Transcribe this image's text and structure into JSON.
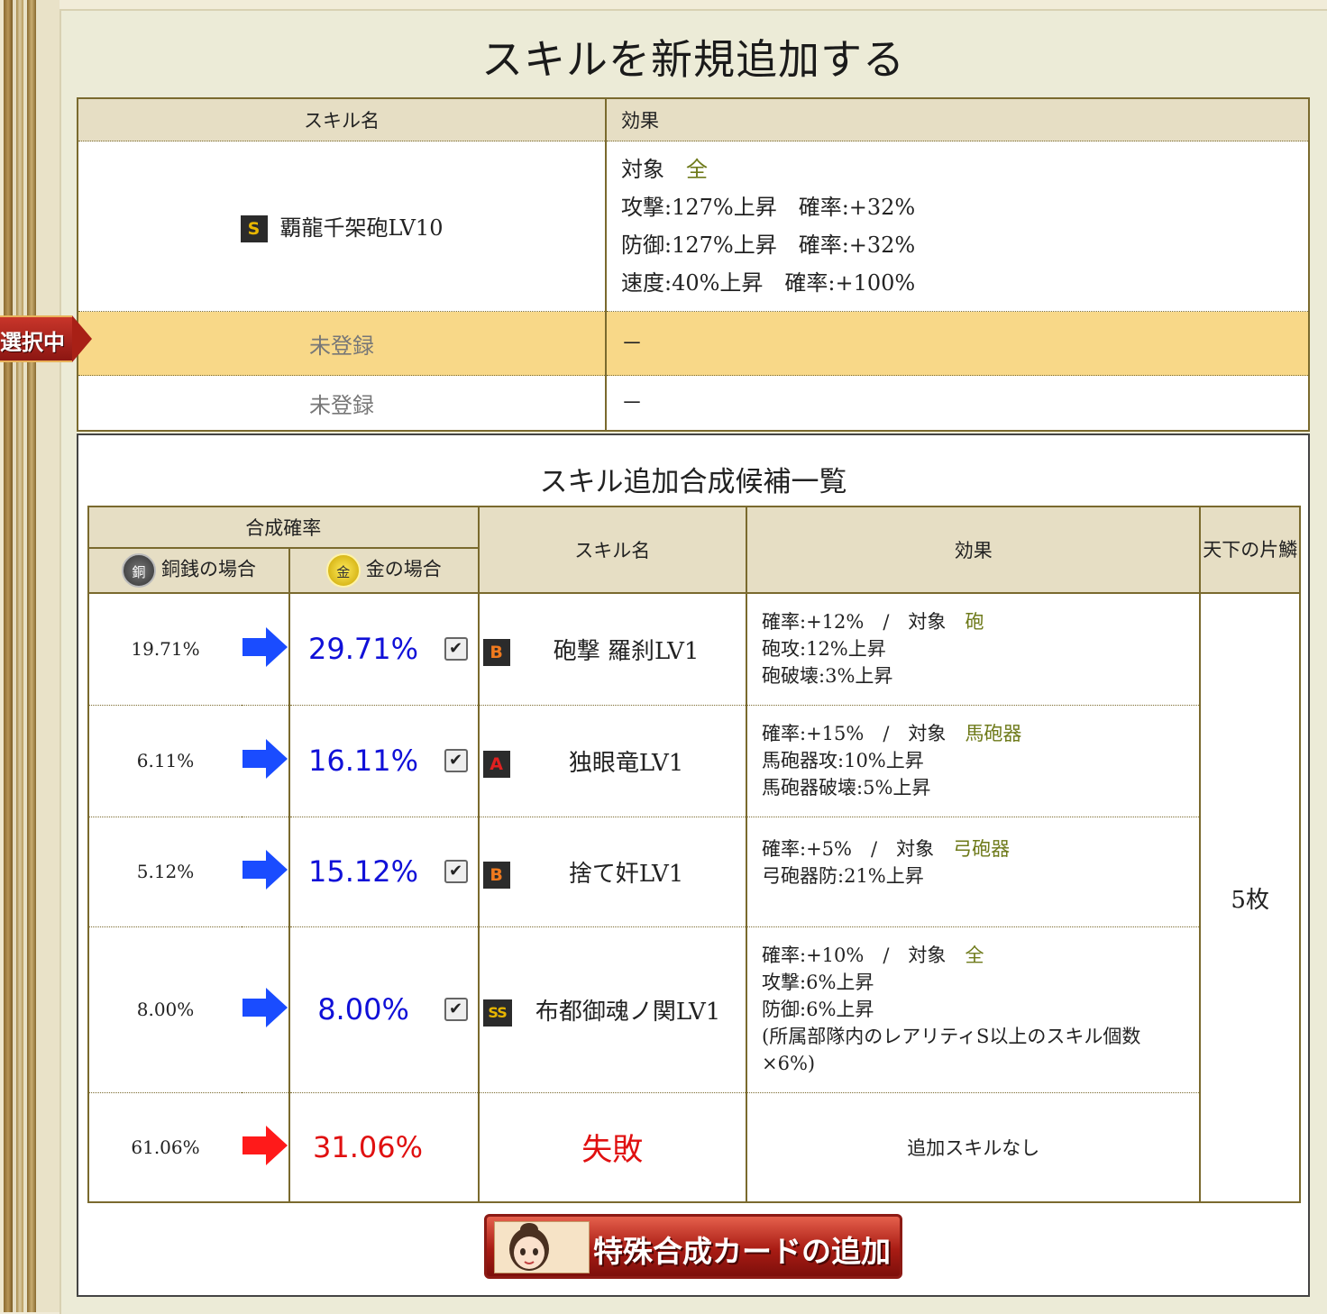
{
  "title": "スキルを新規追加する",
  "selected_tab": "選択中",
  "skills_table": {
    "col_name": "スキル名",
    "col_effect": "効果",
    "rows": [
      {
        "rank": "S",
        "name": "覇龍千架砲LV10",
        "target_label": "対象",
        "target_value": "全",
        "lines": [
          "攻撃:127%上昇　確率:+32%",
          "防御:127%上昇　確率:+32%",
          "速度:40%上昇　確率:+100%"
        ]
      },
      {
        "name": "未登録",
        "effect": "－"
      },
      {
        "name": "未登録",
        "effect": "－"
      }
    ]
  },
  "candidates": {
    "title": "スキル追加合成候補一覧",
    "col_rate": "合成確率",
    "col_copper": "銅銭の場合",
    "col_gold": "金の場合",
    "col_name": "スキル名",
    "col_effect": "効果",
    "col_tenka": "天下の片鱗",
    "tenka_value": "5枚",
    "coin_copper_glyph": "銅",
    "coin_gold_glyph": "金",
    "rows": [
      {
        "copper": "19.71%",
        "gold": "29.71%",
        "rank": "B",
        "name": "砲撃 羅刹LV1",
        "head": "確率:+12%　/　対象",
        "target": "砲",
        "lines": [
          "砲攻:12%上昇",
          "砲破壊:3%上昇"
        ]
      },
      {
        "copper": "6.11%",
        "gold": "16.11%",
        "rank": "A",
        "name": "独眼竜LV1",
        "head": "確率:+15%　/　対象",
        "target": "馬砲器",
        "lines": [
          "馬砲器攻:10%上昇",
          "馬砲器破壊:5%上昇"
        ]
      },
      {
        "copper": "5.12%",
        "gold": "15.12%",
        "rank": "B",
        "name": "捨て奸LV1",
        "head": "確率:+5%　/　対象",
        "target": "弓砲器",
        "lines": [
          "弓砲器防:21%上昇"
        ]
      },
      {
        "copper": "8.00%",
        "gold": "8.00%",
        "rank": "SS",
        "name": "布都御魂ノ関LV1",
        "head": "確率:+10%　/　対象",
        "target": "全",
        "lines": [
          "攻撃:6%上昇",
          "防御:6%上昇",
          "(所属部隊内のレアリティS以上のスキル個数",
          "×6%)"
        ]
      },
      {
        "copper": "61.06%",
        "gold": "31.06%",
        "name": "失敗",
        "effect": "追加スキルなし"
      }
    ]
  },
  "button_label": "特殊合成カードの追加",
  "colors": {
    "blue_arrow": "#1a4cff",
    "red_arrow": "#ff1a1a",
    "selected_row": "#f8d888"
  }
}
